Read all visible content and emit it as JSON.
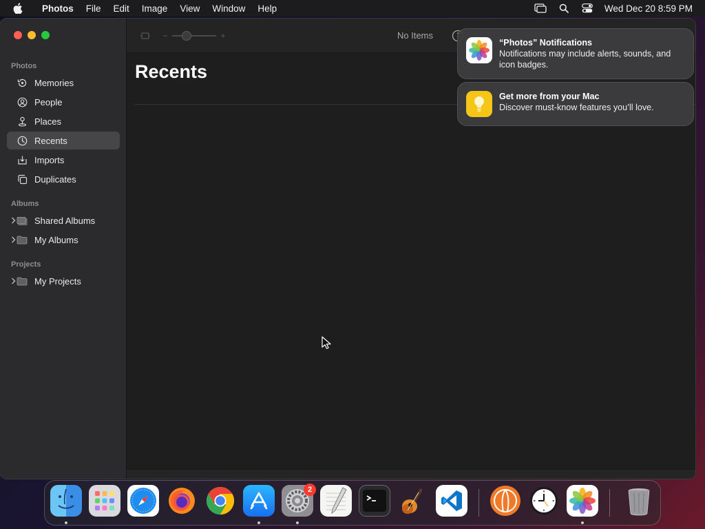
{
  "menubar": {
    "app_name": "Photos",
    "items": [
      "File",
      "Edit",
      "Image",
      "View",
      "Window",
      "Help"
    ],
    "clock": "Wed Dec 20  8:59 PM"
  },
  "sidebar": {
    "section_photos": "Photos",
    "photos_items": [
      {
        "label": "Memories",
        "icon": "memories-icon"
      },
      {
        "label": "People",
        "icon": "people-icon"
      },
      {
        "label": "Places",
        "icon": "places-icon"
      },
      {
        "label": "Recents",
        "icon": "recents-icon",
        "selected": true
      },
      {
        "label": "Imports",
        "icon": "imports-icon"
      },
      {
        "label": "Duplicates",
        "icon": "duplicates-icon"
      }
    ],
    "section_albums": "Albums",
    "album_items": [
      {
        "label": "Shared Albums",
        "icon": "shared-albums-icon"
      },
      {
        "label": "My Albums",
        "icon": "folder-icon"
      }
    ],
    "section_projects": "Projects",
    "project_items": [
      {
        "label": "My Projects",
        "icon": "folder-icon"
      }
    ]
  },
  "toolbar": {
    "status": "No Items"
  },
  "main": {
    "title": "Recents"
  },
  "notifications": [
    {
      "title": "“Photos” Notifications",
      "body": "Notifications may include alerts, sounds, and icon badges."
    },
    {
      "title": "Get more from your Mac",
      "body": "Discover must-know features you’ll love."
    }
  ],
  "dock": {
    "items": [
      "Finder",
      "Launchpad",
      "Safari",
      "Firefox",
      "Chrome",
      "App Store",
      "System Settings",
      "TextEdit",
      "Terminal",
      "GarageBand",
      "Visual Studio Code",
      "Anaconda Navigator",
      "Clock",
      "Photos",
      "Trash"
    ],
    "settings_badge": "2"
  },
  "colors": {
    "accent_selected": "#464649",
    "badge": "#ff3b30"
  }
}
